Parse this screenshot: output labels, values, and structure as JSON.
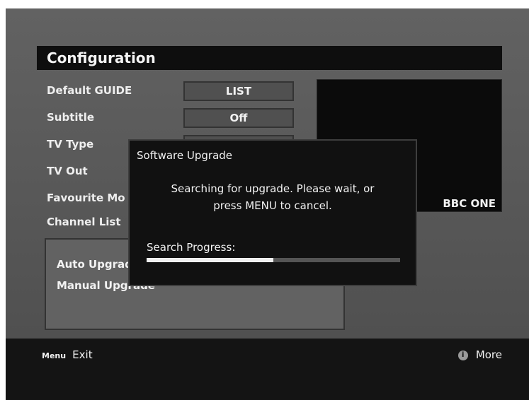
{
  "config": {
    "title": "Configuration",
    "rows": [
      {
        "label": "Default GUIDE",
        "value": "LIST"
      },
      {
        "label": "Subtitle",
        "value": "Off"
      },
      {
        "label": "TV Type",
        "value": ""
      },
      {
        "label": "TV Out",
        "value": ""
      },
      {
        "label": "Favourite Mo",
        "value": ""
      },
      {
        "label": "Channel List",
        "value": ""
      }
    ]
  },
  "preview": {
    "channel": "BBC ONE"
  },
  "upgrade_panel": {
    "items": [
      "Auto Upgrad",
      "Manual Upgrade"
    ]
  },
  "dialog": {
    "title": "Software Upgrade",
    "message_line1": "Searching for upgrade. Please wait, or",
    "message_line2": "press MENU to cancel.",
    "progress_label": "Search Progress:",
    "progress_fraction": 0.5
  },
  "footer": {
    "menu_key": "Menu",
    "left_label": "Exit",
    "right_icon": "info-icon",
    "right_label": "More"
  }
}
